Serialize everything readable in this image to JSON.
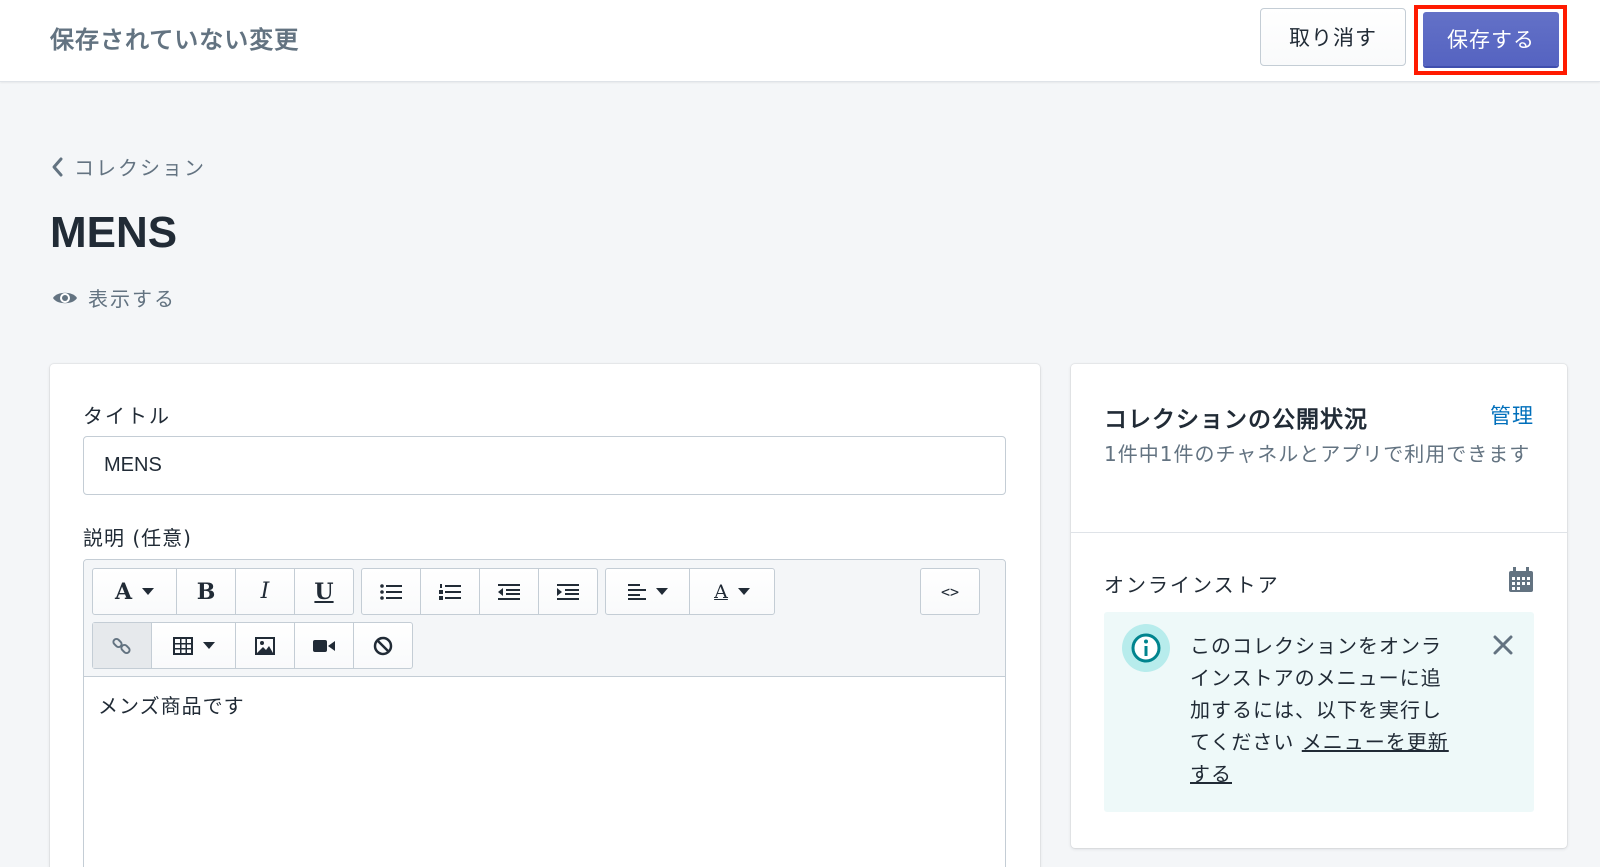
{
  "topbar": {
    "title": "保存されていない変更",
    "discard_label": "取り消す",
    "save_label": "保存する"
  },
  "breadcrumb": {
    "label": "コレクション"
  },
  "page": {
    "title": "MENS",
    "view_label": "表示する"
  },
  "form": {
    "title_label": "タイトル",
    "title_value": "MENS",
    "description_label": "説明 (任意)",
    "description_content": "メンズ商品です"
  },
  "toolbar": {
    "font_letter": "A",
    "bold_letter": "B",
    "italic_letter": "I",
    "underline_letter": "U",
    "color_letter": "A",
    "code_label": "<>"
  },
  "side": {
    "title": "コレクションの公開状況",
    "manage_label": "管理",
    "subtitle": "1件中1件のチャネルとアプリで利用できます",
    "store_label": "オンラインストア",
    "banner_text": "このコレクションをオンラインストアのメニューに追加するには、以下を実行してください",
    "banner_link": "メニューを更新する"
  },
  "colors": {
    "primary": "#5c6ac4",
    "highlight": "#ff1a00",
    "link": "#006fbb",
    "banner_bg": "#eef9f9"
  }
}
